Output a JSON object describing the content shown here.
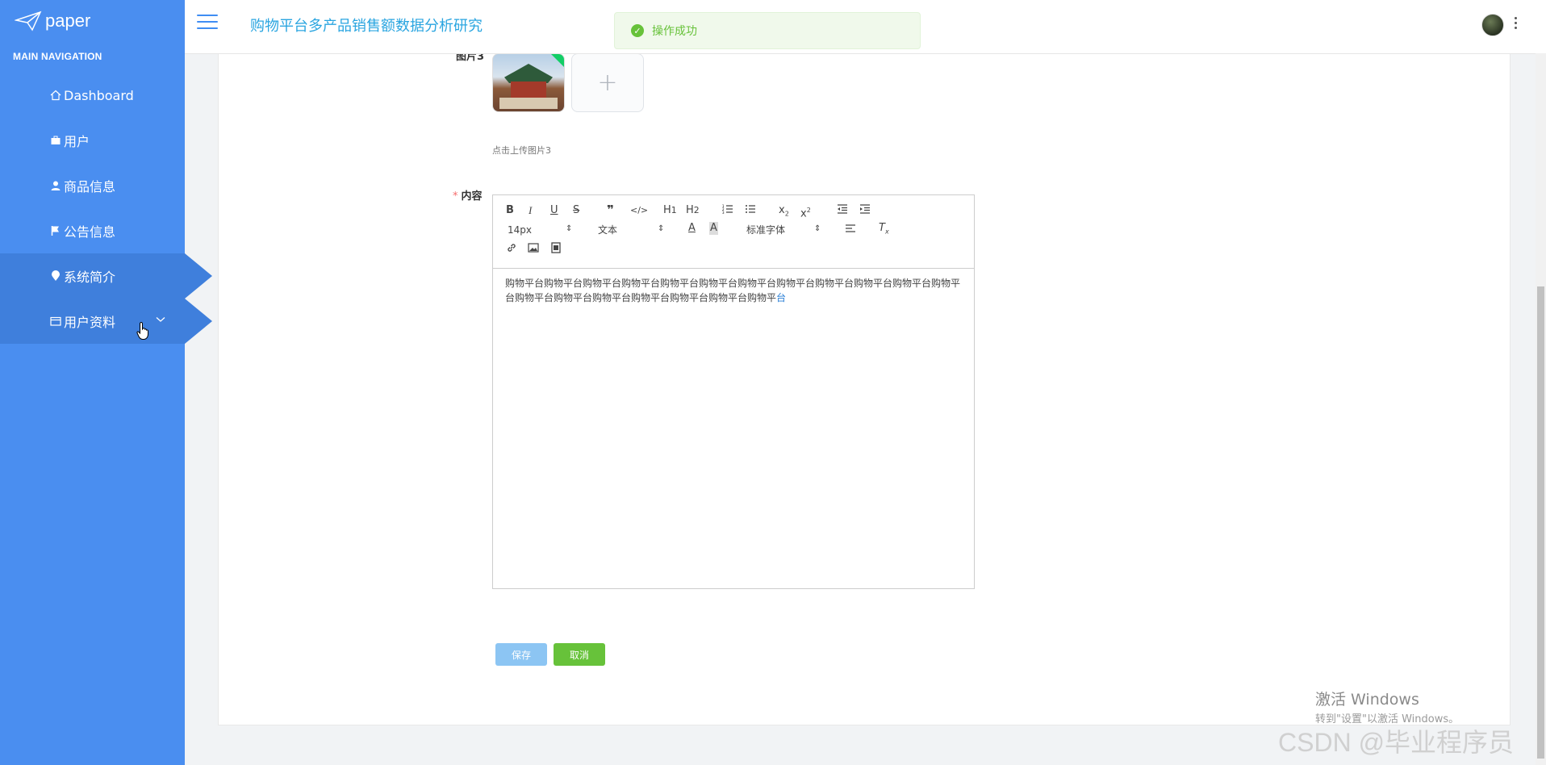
{
  "brand": {
    "name": "paper"
  },
  "sidebar": {
    "heading": "MAIN NAVIGATION",
    "items": [
      {
        "label": "Dashboard",
        "icon": "home-icon"
      },
      {
        "label": "用户",
        "icon": "briefcase-icon"
      },
      {
        "label": "商品信息",
        "icon": "user-icon"
      },
      {
        "label": "公告信息",
        "icon": "flag-icon"
      },
      {
        "label": "系统简介",
        "icon": "pin-icon",
        "active": true
      },
      {
        "label": "用户资料",
        "icon": "card-icon",
        "expandable": true,
        "active": true
      }
    ]
  },
  "header": {
    "title": "购物平台多产品销售额数据分析研究"
  },
  "toast": {
    "message": "操作成功"
  },
  "form": {
    "image3_label": "图片3",
    "image3_hint": "点击上传图片3",
    "upload_plus": "+",
    "content_required": "*",
    "content_label": "内容",
    "editor": {
      "font_size": "14px",
      "heading_select": "文本",
      "font_family": "标准字体",
      "content": "购物平台购物平台购物平台购物平台购物平台购物平台购物平台购物平台购物平台购物平台购物平台购物平台购物平台购物平台购物平台购物平台购物平台购物平台购物平",
      "content_tail": "台"
    },
    "save_label": "保存",
    "cancel_label": "取消"
  },
  "overlay": {
    "activate_title": "激活 Windows",
    "activate_sub": "转到\"设置\"以激活 Windows。",
    "csdn": "CSDN @毕业程序员"
  },
  "colors": {
    "sidebar": "#4a8ef0",
    "sidebar_active": "#3f7fdc",
    "title": "#2aa5e0",
    "success": "#67c23a"
  }
}
